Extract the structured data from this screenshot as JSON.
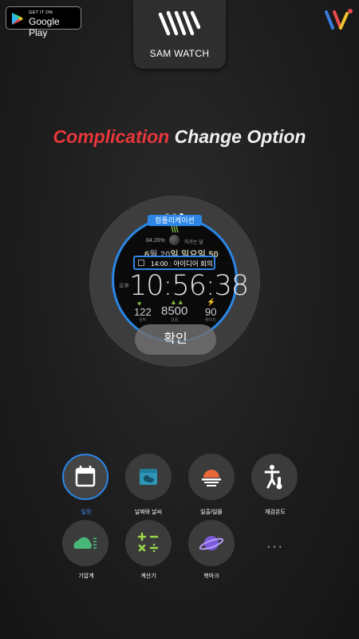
{
  "store_badge": {
    "small": "GET IT ON",
    "big": "Google Play"
  },
  "brand": {
    "name": "SAM WATCH"
  },
  "headline": {
    "part1": "Complication",
    "part2": "Change Option"
  },
  "watch": {
    "tag": "컴플리케이션",
    "battery": "84.26%",
    "moon_label": "차가는 달",
    "date_prefix": "6",
    "date_main": "월 20",
    "date_suffix": "일 일요일",
    "date_end": " 50",
    "event": "14:00 : 아이디어 회의",
    "ampm": "오후",
    "time": "10:56:38",
    "heart_value": "122",
    "heart_label": "심박",
    "steps_value": "8500",
    "steps_label": "걸음",
    "battery_value": "90",
    "battery_label": "배터리"
  },
  "confirm": {
    "label": "확인"
  },
  "complications": [
    {
      "label": "일정",
      "icon": "calendar-icon"
    },
    {
      "label": "날짜와 날씨",
      "icon": "date-weather-icon"
    },
    {
      "label": "일출/일몰",
      "icon": "sunrise-sunset-icon"
    },
    {
      "label": "체감온도",
      "icon": "feels-like-temp-icon"
    },
    {
      "label": "기압계",
      "icon": "barometer-icon"
    },
    {
      "label": "계산기",
      "icon": "calculator-icon"
    },
    {
      "label": "북마크",
      "icon": "bookmark-planet-icon"
    }
  ],
  "more": {
    "label": "···"
  },
  "colors": {
    "accent": "#2b86e6",
    "headline_red": "#e8373c",
    "green": "#7bb042"
  }
}
